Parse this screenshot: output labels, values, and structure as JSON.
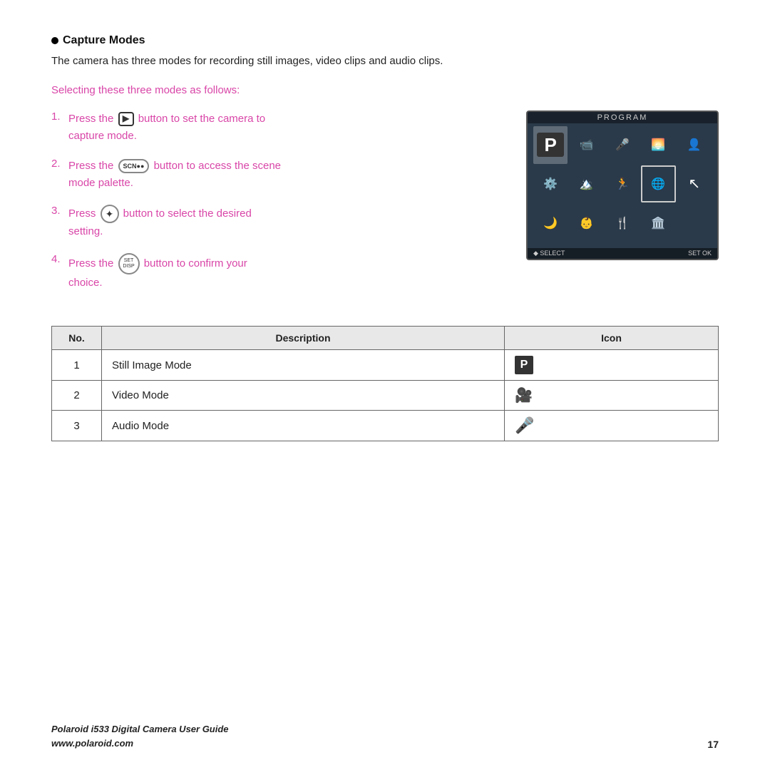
{
  "page": {
    "title": "Capture Modes",
    "intro_text": "The camera has three modes for recording still images, video clips and audio clips.",
    "sub_heading": "Selecting these three modes as follows:",
    "steps": [
      {
        "number": "1.",
        "text_before": "Press the",
        "button_type": "play",
        "text_after": "button to set the camera to capture mode."
      },
      {
        "number": "2.",
        "text_before": "Press the",
        "button_type": "scn",
        "text_after": "button to access the scene mode palette."
      },
      {
        "number": "3.",
        "text_before": "Press",
        "button_type": "nav",
        "text_after": "button to select the desired setting."
      },
      {
        "number": "4.",
        "text_before": "Press the",
        "button_type": "set",
        "text_after": "button to confirm your choice."
      }
    ],
    "camera_screen": {
      "label": "PROGRAM"
    },
    "table": {
      "headers": [
        "No.",
        "Description",
        "Icon"
      ],
      "rows": [
        {
          "no": "1",
          "description": "Still Image Mode",
          "icon": "P"
        },
        {
          "no": "2",
          "description": "Video Mode",
          "icon": "video"
        },
        {
          "no": "3",
          "description": "Audio Mode",
          "icon": "mic"
        }
      ]
    },
    "footer": {
      "left_line1": "Polaroid i533 Digital Camera User Guide",
      "left_line2": "www.polaroid.com",
      "right": "17"
    }
  }
}
